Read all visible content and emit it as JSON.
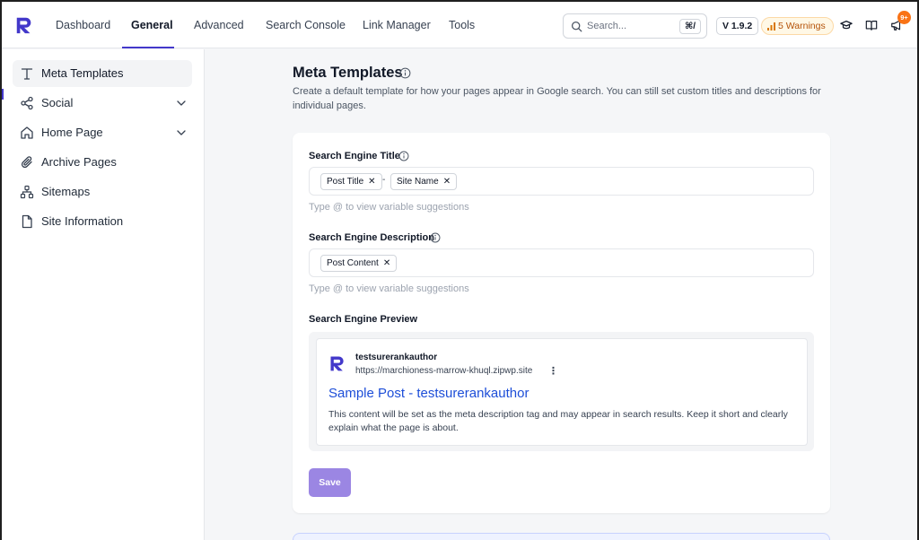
{
  "nav": {
    "items": [
      {
        "label": "Dashboard"
      },
      {
        "label": "General"
      },
      {
        "label": "Advanced"
      },
      {
        "label": "Search Console"
      },
      {
        "label": "Link Manager"
      },
      {
        "label": "Tools"
      }
    ],
    "active": "General",
    "search": {
      "placeholder": "Search...",
      "shortcut": "⌘/"
    },
    "version": "V 1.9.2",
    "warnings": "5 Warnings",
    "notification_count": "9+"
  },
  "sidebar": {
    "items": [
      {
        "label": "Meta Templates",
        "icon": "text-t-icon",
        "active": true
      },
      {
        "label": "Social",
        "icon": "share-icon",
        "expandable": true
      },
      {
        "label": "Home Page",
        "icon": "home-icon",
        "expandable": true
      },
      {
        "label": "Archive Pages",
        "icon": "paperclip-icon"
      },
      {
        "label": "Sitemaps",
        "icon": "sitemap-icon"
      },
      {
        "label": "Site Information",
        "icon": "file-icon"
      }
    ]
  },
  "main": {
    "title": "Meta Templates",
    "description": "Create a default template for how your pages appear in Google search. You can still set custom titles and descriptions for individual pages.",
    "title_field": {
      "label": "Search Engine Title",
      "tags": [
        "Post Title",
        "Site Name"
      ],
      "separator": "-",
      "hint": "Type @ to view variable suggestions"
    },
    "description_field": {
      "label": "Search Engine Description",
      "tags": [
        "Post Content"
      ],
      "hint": "Type @ to view variable suggestions"
    },
    "preview": {
      "label": "Search Engine Preview",
      "site_name": "testsurerankauthor",
      "url": "https://marchioness-marrow-khuql.zipwp.site",
      "title": "Sample Post - testsurerankauthor",
      "description": "This content will be set as the meta description tag and may appear in search results. Keep it short and clearly explain what the page is about."
    },
    "save_label": "Save"
  },
  "colors": {
    "accent": "#4338ca",
    "save_button": "#9b86e3",
    "link_blue": "#1d4ed8",
    "warning_text": "#b45309",
    "badge": "#f97316"
  }
}
